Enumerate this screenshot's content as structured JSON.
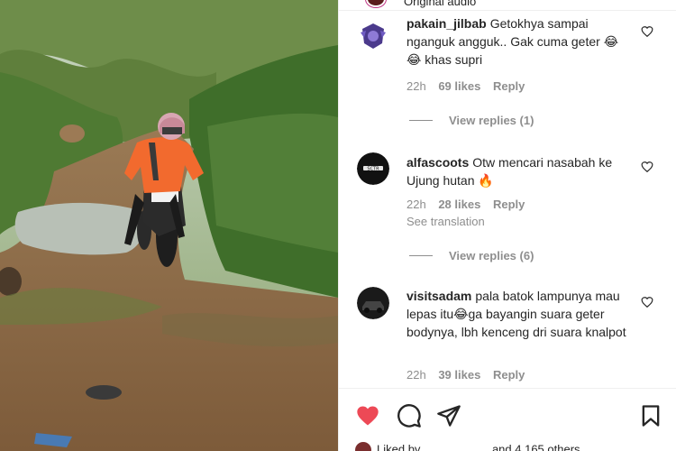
{
  "header": {
    "audio_label": "Original audio"
  },
  "comments": [
    {
      "username": "pakain_jilbab",
      "text": "Getokhya sampai nganguk angguk.. Gak cuma geter 😂 😂 khas supri",
      "time": "22h",
      "likes": "69 likes",
      "reply": "Reply",
      "view_replies": "View replies (1)",
      "avatar_icon": "purple-badge-avatar-icon"
    },
    {
      "username": "alfascoots",
      "text": "Otw mencari nasabah ke Ujung hutan 🔥",
      "time": "22h",
      "likes": "28 likes",
      "reply": "Reply",
      "see_translation": "See translation",
      "view_replies": "View replies (6)",
      "avatar_icon": "dark-logo-avatar-icon"
    },
    {
      "username": "visitsadam",
      "text": "pala batok lampunya mau lepas itu😂ga bayangin suara geter bodynya, lbh kenceng dri suara knalpot",
      "time": "22h",
      "likes": "39 likes",
      "reply": "Reply",
      "avatar_icon": "car-photo-avatar-icon"
    }
  ],
  "footer": {
    "likes_text": "Liked by __________ and 4,165 others"
  },
  "colors": {
    "like_red": "#ed4956",
    "muted_text": "#8e8e8e",
    "primary_text": "#262626",
    "border": "#efefef"
  }
}
